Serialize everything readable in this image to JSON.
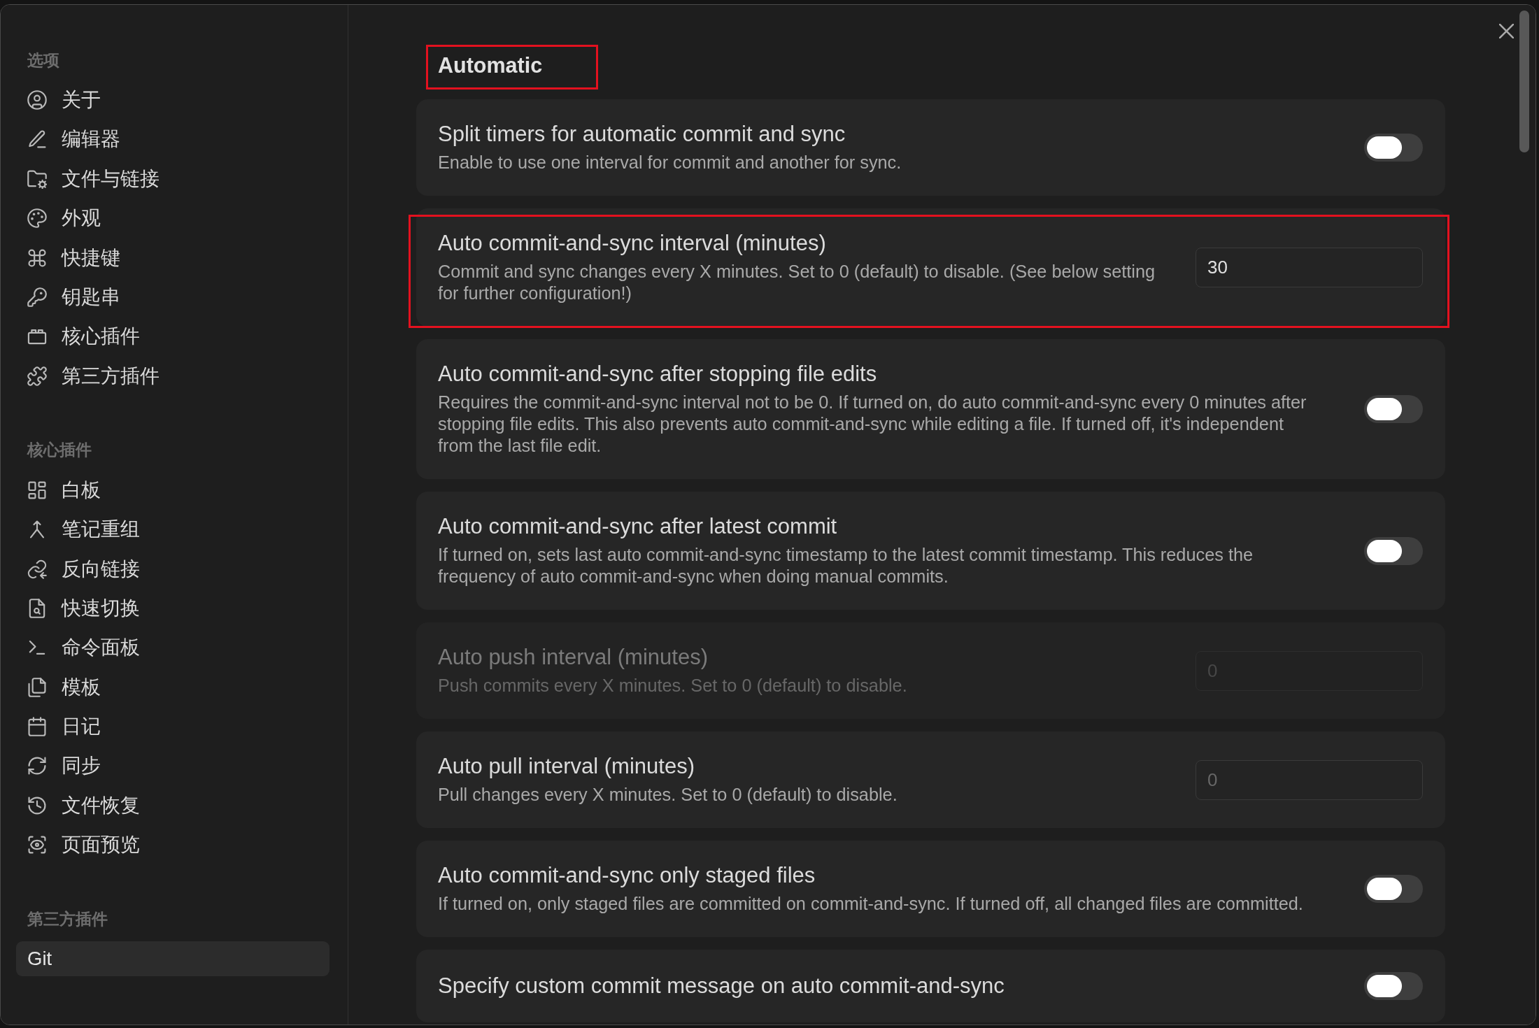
{
  "sidebar": {
    "sections": [
      {
        "heading": "选项",
        "items": [
          {
            "label": "关于",
            "selected": false
          },
          {
            "label": "编辑器",
            "selected": false
          },
          {
            "label": "文件与链接",
            "selected": false
          },
          {
            "label": "外观",
            "selected": false
          },
          {
            "label": "快捷键",
            "selected": false
          },
          {
            "label": "钥匙串",
            "selected": false
          },
          {
            "label": "核心插件",
            "selected": false
          },
          {
            "label": "第三方插件",
            "selected": false
          }
        ]
      },
      {
        "heading": "核心插件",
        "items": [
          {
            "label": "白板",
            "selected": false
          },
          {
            "label": "笔记重组",
            "selected": false
          },
          {
            "label": "反向链接",
            "selected": false
          },
          {
            "label": "快速切换",
            "selected": false
          },
          {
            "label": "命令面板",
            "selected": false
          },
          {
            "label": "模板",
            "selected": false
          },
          {
            "label": "日记",
            "selected": false
          },
          {
            "label": "同步",
            "selected": false
          },
          {
            "label": "文件恢复",
            "selected": false
          },
          {
            "label": "页面预览",
            "selected": false
          }
        ]
      },
      {
        "heading": "第三方插件",
        "items": [
          {
            "label": "Git",
            "selected": true
          }
        ]
      }
    ]
  },
  "content": {
    "section": {
      "title": "Automatic",
      "highlighted": true
    },
    "settings": [
      {
        "kind": "toggle",
        "title": "Split timers for automatic commit and sync",
        "description": "Enable to use one interval for commit and another for sync.",
        "on": false,
        "highlighted": false,
        "disabled": false
      },
      {
        "kind": "number",
        "title": "Auto commit-and-sync interval (minutes)",
        "description": "Commit and sync changes every X minutes. Set to 0 (default) to disable. (See below setting for further configuration!)",
        "value": "30",
        "highlighted": true,
        "disabled": false
      },
      {
        "kind": "toggle",
        "title": "Auto commit-and-sync after stopping file edits",
        "description": "Requires the commit-and-sync interval not to be 0. If turned on, do auto commit-and-sync every 0 minutes after stopping file edits. This also prevents auto commit-and-sync while editing a file. If turned off, it's independent from the last file edit.",
        "on": false,
        "highlighted": false,
        "disabled": false
      },
      {
        "kind": "toggle",
        "title": "Auto commit-and-sync after latest commit",
        "description": "If turned on, sets last auto commit-and-sync timestamp to the latest commit timestamp. This reduces the frequency of auto commit-and-sync when doing manual commits.",
        "on": false,
        "highlighted": false,
        "disabled": false
      },
      {
        "kind": "number",
        "title": "Auto push interval (minutes)",
        "description": "Push commits every X minutes. Set to 0 (default) to disable.",
        "placeholder": "0",
        "highlighted": false,
        "disabled": true
      },
      {
        "kind": "number",
        "title": "Auto pull interval (minutes)",
        "description": "Pull changes every X minutes. Set to 0 (default) to disable.",
        "placeholder": "0",
        "highlighted": false,
        "disabled": false
      },
      {
        "kind": "toggle",
        "title": "Auto commit-and-sync only staged files",
        "description": "If turned on, only staged files are committed on commit-and-sync. If turned off, all changed files are committed.",
        "on": false,
        "highlighted": false,
        "disabled": false
      },
      {
        "kind": "toggle",
        "title": "Specify custom commit message on auto commit-and-sync",
        "on": false,
        "highlighted": false,
        "disabled": false
      }
    ]
  }
}
